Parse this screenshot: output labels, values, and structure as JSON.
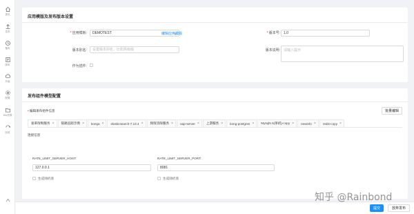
{
  "sidebar": {
    "items": [
      {
        "label": "首页",
        "icon": "home-icon"
      },
      {
        "label": "发布",
        "icon": "upload-icon"
      },
      {
        "label": "备份",
        "icon": "history-icon"
      },
      {
        "label": "脚本",
        "icon": "script-icon"
      },
      {
        "label": "升级",
        "icon": "cloud-upload-icon"
      },
      {
        "label": "配置",
        "icon": "gear-icon"
      },
      {
        "label": "k8s资源",
        "icon": "folder-icon"
      },
      {
        "label": "回收",
        "icon": "recycle-icon"
      }
    ],
    "bottom_icon": "settings-icon"
  },
  "settings_card": {
    "title": "应用模版及发布版本设置",
    "template_label": "应用模板:",
    "template_value": "DEMOTEST",
    "edit_template_link": "编辑应用模版",
    "version_label": "版本号:",
    "version_value": "1.0",
    "alias_label": "版本别名:",
    "alias_placeholder": "设置版本别名，比如高级版",
    "description_label": "版本说明:",
    "description_placeholder": "请输入提示",
    "plugin_label": "作为插件:"
  },
  "components_card": {
    "title": "发布组件模型配置",
    "edit_info_label": "编辑发布组件信息",
    "batch_edit_button": "批量编辑",
    "tabs": [
      {
        "label": "速率限制服务",
        "active": true
      },
      {
        "label": "链路追踪示例",
        "active": false
      },
      {
        "label": "konga",
        "active": false
      },
      {
        "label": "elasticsearch-7.13.4",
        "active": false
      },
      {
        "label": "频限流限服务",
        "active": false
      },
      {
        "label": "oap-server",
        "active": false
      },
      {
        "label": "上游服务",
        "active": false
      },
      {
        "label": "kong-postgres",
        "active": false
      },
      {
        "label": "Mysql5.5(单机)-copy",
        "active": false
      },
      {
        "label": "newinfo",
        "active": false
      },
      {
        "label": "redis-copy",
        "active": false
      }
    ],
    "tab_close_glyph": "×",
    "section_label": "连接信息",
    "host_label": "RATE_LIMIT_SERVER_HOST:",
    "host_value": "127.0.0.1",
    "port_label": "RATE_LIMIT_SERVER_PORT:",
    "port_value": "8081",
    "random_value_label": "生成随机值"
  },
  "footer": {
    "submit_button": "提交",
    "cancel_button": "放弃发布"
  },
  "watermark": "知乎 @Rainbond"
}
